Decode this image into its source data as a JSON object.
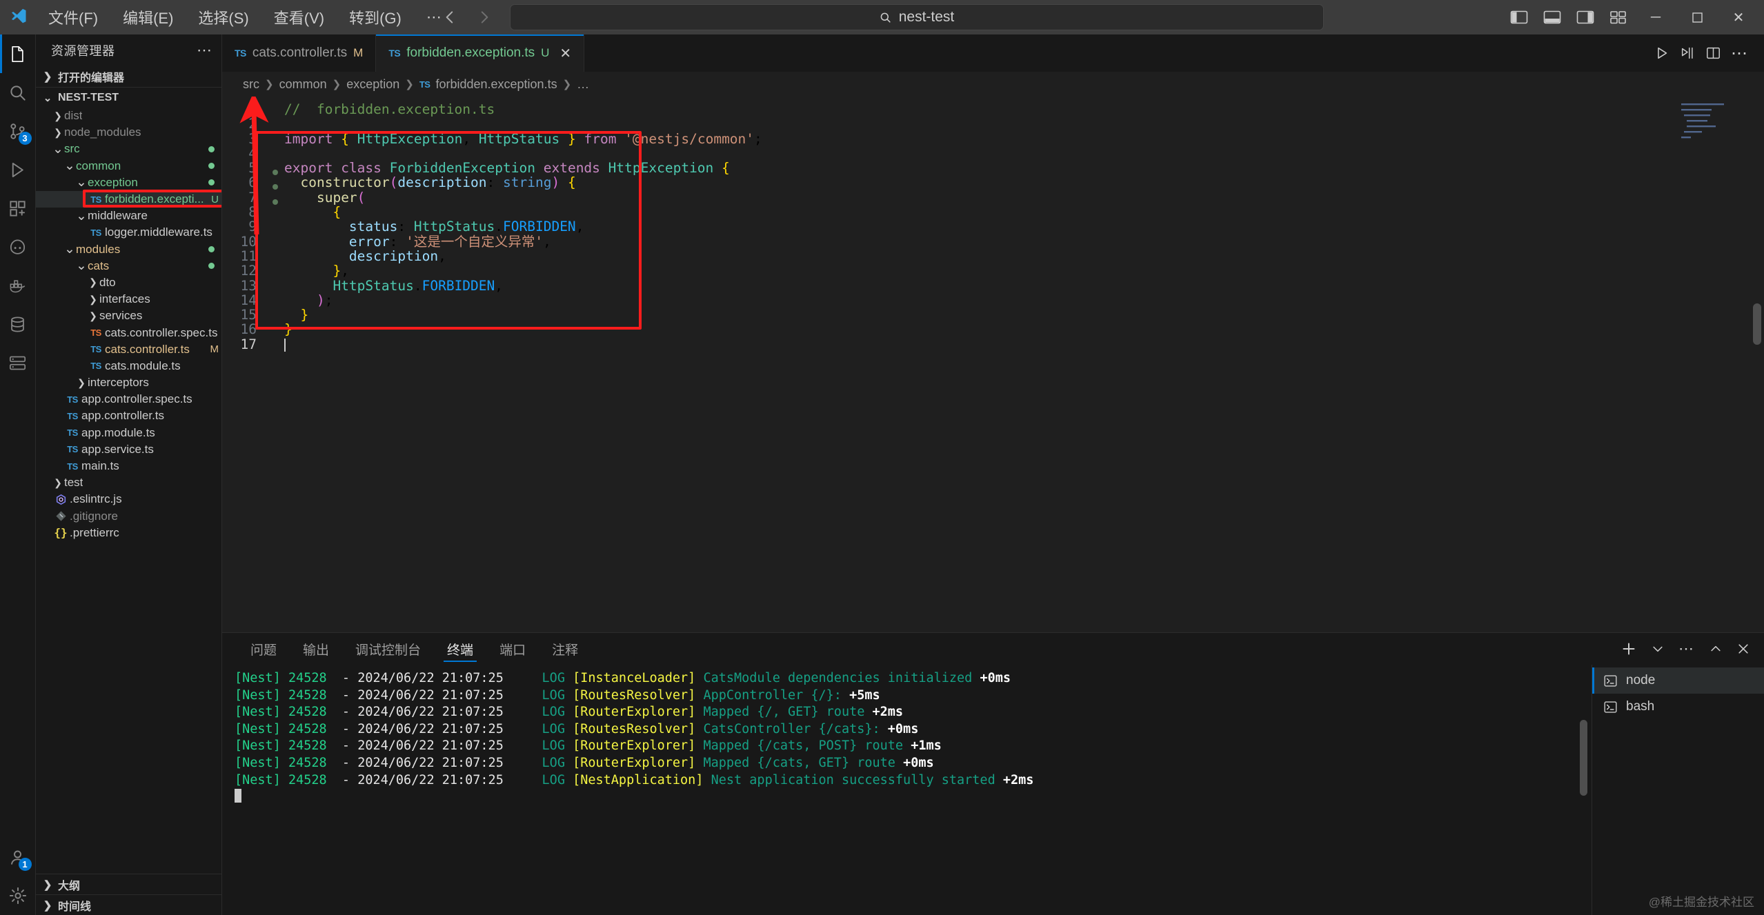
{
  "titlebar": {
    "logo_icon": "vscode-logo-icon",
    "menus": [
      "文件(F)",
      "编辑(E)",
      "选择(S)",
      "查看(V)",
      "转到(G)",
      "⋯"
    ],
    "nav_back_icon": "arrow-left-icon",
    "nav_forward_icon": "arrow-right-icon",
    "search_value": "nest-test",
    "search_icon": "search-icon",
    "layout_icons": [
      "toggle-primary-sidebar-icon",
      "toggle-panel-icon",
      "toggle-secondary-sidebar-icon",
      "customize-layout-icon"
    ],
    "window_minimize": "─",
    "window_maximize": "☐",
    "window_close": "✕"
  },
  "activitybar": {
    "items": [
      {
        "name": "explorer",
        "icon": "files-icon",
        "active": true,
        "badge": ""
      },
      {
        "name": "search",
        "icon": "search-icon",
        "active": false,
        "badge": ""
      },
      {
        "name": "source-control",
        "icon": "source-control-icon",
        "active": false,
        "badge": "3"
      },
      {
        "name": "run-and-debug",
        "icon": "debug-icon",
        "active": false,
        "badge": ""
      },
      {
        "name": "extensions",
        "icon": "extensions-icon",
        "active": false,
        "badge": ""
      },
      {
        "name": "copilot",
        "icon": "copilot-icon",
        "active": false,
        "badge": ""
      },
      {
        "name": "docker",
        "icon": "docker-icon",
        "active": false,
        "badge": ""
      },
      {
        "name": "database",
        "icon": "database-icon",
        "active": false,
        "badge": ""
      },
      {
        "name": "remote",
        "icon": "remote-explorer-icon",
        "active": false,
        "badge": ""
      }
    ],
    "bottom_items": [
      {
        "name": "accounts",
        "icon": "account-icon",
        "badge": "1"
      },
      {
        "name": "settings",
        "icon": "gear-icon",
        "badge": ""
      }
    ]
  },
  "sidebar": {
    "title": "资源管理器",
    "more_actions_icon": "ellipsis-icon",
    "open_editors_label": "打开的编辑器",
    "project_label": "NEST-TEST",
    "tree": [
      {
        "depth": 1,
        "label": "dist",
        "type": "folder",
        "expanded": false,
        "color": "gray"
      },
      {
        "depth": 1,
        "label": "node_modules",
        "type": "folder",
        "expanded": false,
        "color": "gray"
      },
      {
        "depth": 1,
        "label": "src",
        "type": "folder",
        "expanded": true,
        "color": "green",
        "dot": true
      },
      {
        "depth": 2,
        "label": "common",
        "type": "folder",
        "expanded": true,
        "color": "green",
        "dot": true
      },
      {
        "depth": 3,
        "label": "exception",
        "type": "folder",
        "expanded": true,
        "color": "green",
        "dot": true
      },
      {
        "depth": 4,
        "label": "forbidden.excepti...",
        "type": "ts",
        "color": "green",
        "status": "U",
        "selected": true,
        "highlight": true
      },
      {
        "depth": 3,
        "label": "middleware",
        "type": "folder",
        "expanded": true,
        "color": "white"
      },
      {
        "depth": 4,
        "label": "logger.middleware.ts",
        "type": "ts",
        "color": "white"
      },
      {
        "depth": 2,
        "label": "modules",
        "type": "folder",
        "expanded": true,
        "color": "tan",
        "dot": true
      },
      {
        "depth": 3,
        "label": "cats",
        "type": "folder",
        "expanded": true,
        "color": "tan",
        "dot": true
      },
      {
        "depth": 4,
        "label": "dto",
        "type": "folder",
        "expanded": false,
        "color": "white"
      },
      {
        "depth": 4,
        "label": "interfaces",
        "type": "folder",
        "expanded": false,
        "color": "white"
      },
      {
        "depth": 4,
        "label": "services",
        "type": "folder",
        "expanded": false,
        "color": "white"
      },
      {
        "depth": 4,
        "label": "cats.controller.spec.ts",
        "type": "ts-test",
        "color": "white"
      },
      {
        "depth": 4,
        "label": "cats.controller.ts",
        "type": "ts",
        "color": "tan",
        "status": "M"
      },
      {
        "depth": 4,
        "label": "cats.module.ts",
        "type": "ts",
        "color": "white"
      },
      {
        "depth": 3,
        "label": "interceptors",
        "type": "folder",
        "expanded": false,
        "color": "white"
      },
      {
        "depth": 2,
        "label": "app.controller.spec.ts",
        "type": "ts",
        "color": "white"
      },
      {
        "depth": 2,
        "label": "app.controller.ts",
        "type": "ts",
        "color": "white"
      },
      {
        "depth": 2,
        "label": "app.module.ts",
        "type": "ts",
        "color": "white"
      },
      {
        "depth": 2,
        "label": "app.service.ts",
        "type": "ts",
        "color": "white"
      },
      {
        "depth": 2,
        "label": "main.ts",
        "type": "ts",
        "color": "white"
      },
      {
        "depth": 1,
        "label": "test",
        "type": "folder",
        "expanded": false,
        "color": "white"
      },
      {
        "depth": 1,
        "label": ".eslintrc.js",
        "type": "eslint",
        "color": "white"
      },
      {
        "depth": 1,
        "label": ".gitignore",
        "type": "git",
        "color": "gray"
      },
      {
        "depth": 1,
        "label": ".prettierrc",
        "type": "json",
        "color": "white"
      }
    ],
    "outline_label": "大纲",
    "timeline_label": "时间线"
  },
  "editor": {
    "tabs": [
      {
        "label": "cats.controller.ts",
        "icon": "typescript-icon",
        "status": "M",
        "active": false,
        "closable": false
      },
      {
        "label": "forbidden.exception.ts",
        "icon": "typescript-icon",
        "status": "U",
        "active": true,
        "closable": true
      }
    ],
    "tab_actions": [
      "run-icon",
      "split-run-icon",
      "split-editor-icon",
      "more-actions-icon"
    ],
    "breadcrumb": [
      "src",
      "common",
      "exception",
      "forbidden.exception.ts",
      "…"
    ],
    "breadcrumb_file_icon": "typescript-icon",
    "line_numbers": [
      1,
      2,
      3,
      4,
      5,
      6,
      7,
      8,
      9,
      10,
      11,
      12,
      13,
      14,
      15,
      16,
      17
    ],
    "code_lines": [
      {
        "n": 1,
        "text": "//  forbidden.exception.ts"
      },
      {
        "n": 2,
        "text": ""
      },
      {
        "n": 3,
        "text": "import { HttpException, HttpStatus } from '@nestjs/common';"
      },
      {
        "n": 4,
        "text": ""
      },
      {
        "n": 5,
        "text": "export class ForbiddenException extends HttpException {"
      },
      {
        "n": 6,
        "text": "  constructor(description: string) {"
      },
      {
        "n": 7,
        "text": "    super("
      },
      {
        "n": 8,
        "text": "      {"
      },
      {
        "n": 9,
        "text": "        status: HttpStatus.FORBIDDEN,"
      },
      {
        "n": 10,
        "text": "        error: '这是一个自定义异常',"
      },
      {
        "n": 11,
        "text": "        description,"
      },
      {
        "n": 12,
        "text": "      },"
      },
      {
        "n": 13,
        "text": "      HttpStatus.FORBIDDEN,"
      },
      {
        "n": 14,
        "text": "    );"
      },
      {
        "n": 15,
        "text": "  }"
      },
      {
        "n": 16,
        "text": "}"
      },
      {
        "n": 17,
        "text": ""
      }
    ],
    "annotation_color": "#fb1c1c"
  },
  "panel": {
    "tabs": [
      "问题",
      "输出",
      "调试控制台",
      "终端",
      "端口",
      "注释"
    ],
    "active_tab": "终端",
    "actions": [
      "new-terminal-icon",
      "chevron-down-icon",
      "ellipsis-icon",
      "chevron-up-icon",
      "close-icon"
    ],
    "terminal_lines": [
      {
        "tag": "[Nest]",
        "pid": "24528",
        "dash": "-",
        "time": "2024/06/22 21:07:25",
        "level": "LOG",
        "ctx": "[InstanceLoader]",
        "msg": "CatsModule dependencies initialized",
        "ms": "+0ms"
      },
      {
        "tag": "[Nest]",
        "pid": "24528",
        "dash": "-",
        "time": "2024/06/22 21:07:25",
        "level": "LOG",
        "ctx": "[RoutesResolver]",
        "msg": "AppController {/}:",
        "ms": "+5ms"
      },
      {
        "tag": "[Nest]",
        "pid": "24528",
        "dash": "-",
        "time": "2024/06/22 21:07:25",
        "level": "LOG",
        "ctx": "[RouterExplorer]",
        "msg": "Mapped {/, GET} route",
        "ms": "+2ms"
      },
      {
        "tag": "[Nest]",
        "pid": "24528",
        "dash": "-",
        "time": "2024/06/22 21:07:25",
        "level": "LOG",
        "ctx": "[RoutesResolver]",
        "msg": "CatsController {/cats}:",
        "ms": "+0ms"
      },
      {
        "tag": "[Nest]",
        "pid": "24528",
        "dash": "-",
        "time": "2024/06/22 21:07:25",
        "level": "LOG",
        "ctx": "[RouterExplorer]",
        "msg": "Mapped {/cats, POST} route",
        "ms": "+1ms"
      },
      {
        "tag": "[Nest]",
        "pid": "24528",
        "dash": "-",
        "time": "2024/06/22 21:07:25",
        "level": "LOG",
        "ctx": "[RouterExplorer]",
        "msg": "Mapped {/cats, GET} route",
        "ms": "+0ms"
      },
      {
        "tag": "[Nest]",
        "pid": "24528",
        "dash": "-",
        "time": "2024/06/22 21:07:25",
        "level": "LOG",
        "ctx": "[NestApplication]",
        "msg": "Nest application successfully started",
        "ms": "+2ms"
      }
    ],
    "terminal_instances": [
      {
        "label": "node",
        "icon": "terminal-icon",
        "active": true
      },
      {
        "label": "bash",
        "icon": "terminal-icon",
        "active": false
      }
    ],
    "watermark": "@稀土掘金技术社区"
  }
}
